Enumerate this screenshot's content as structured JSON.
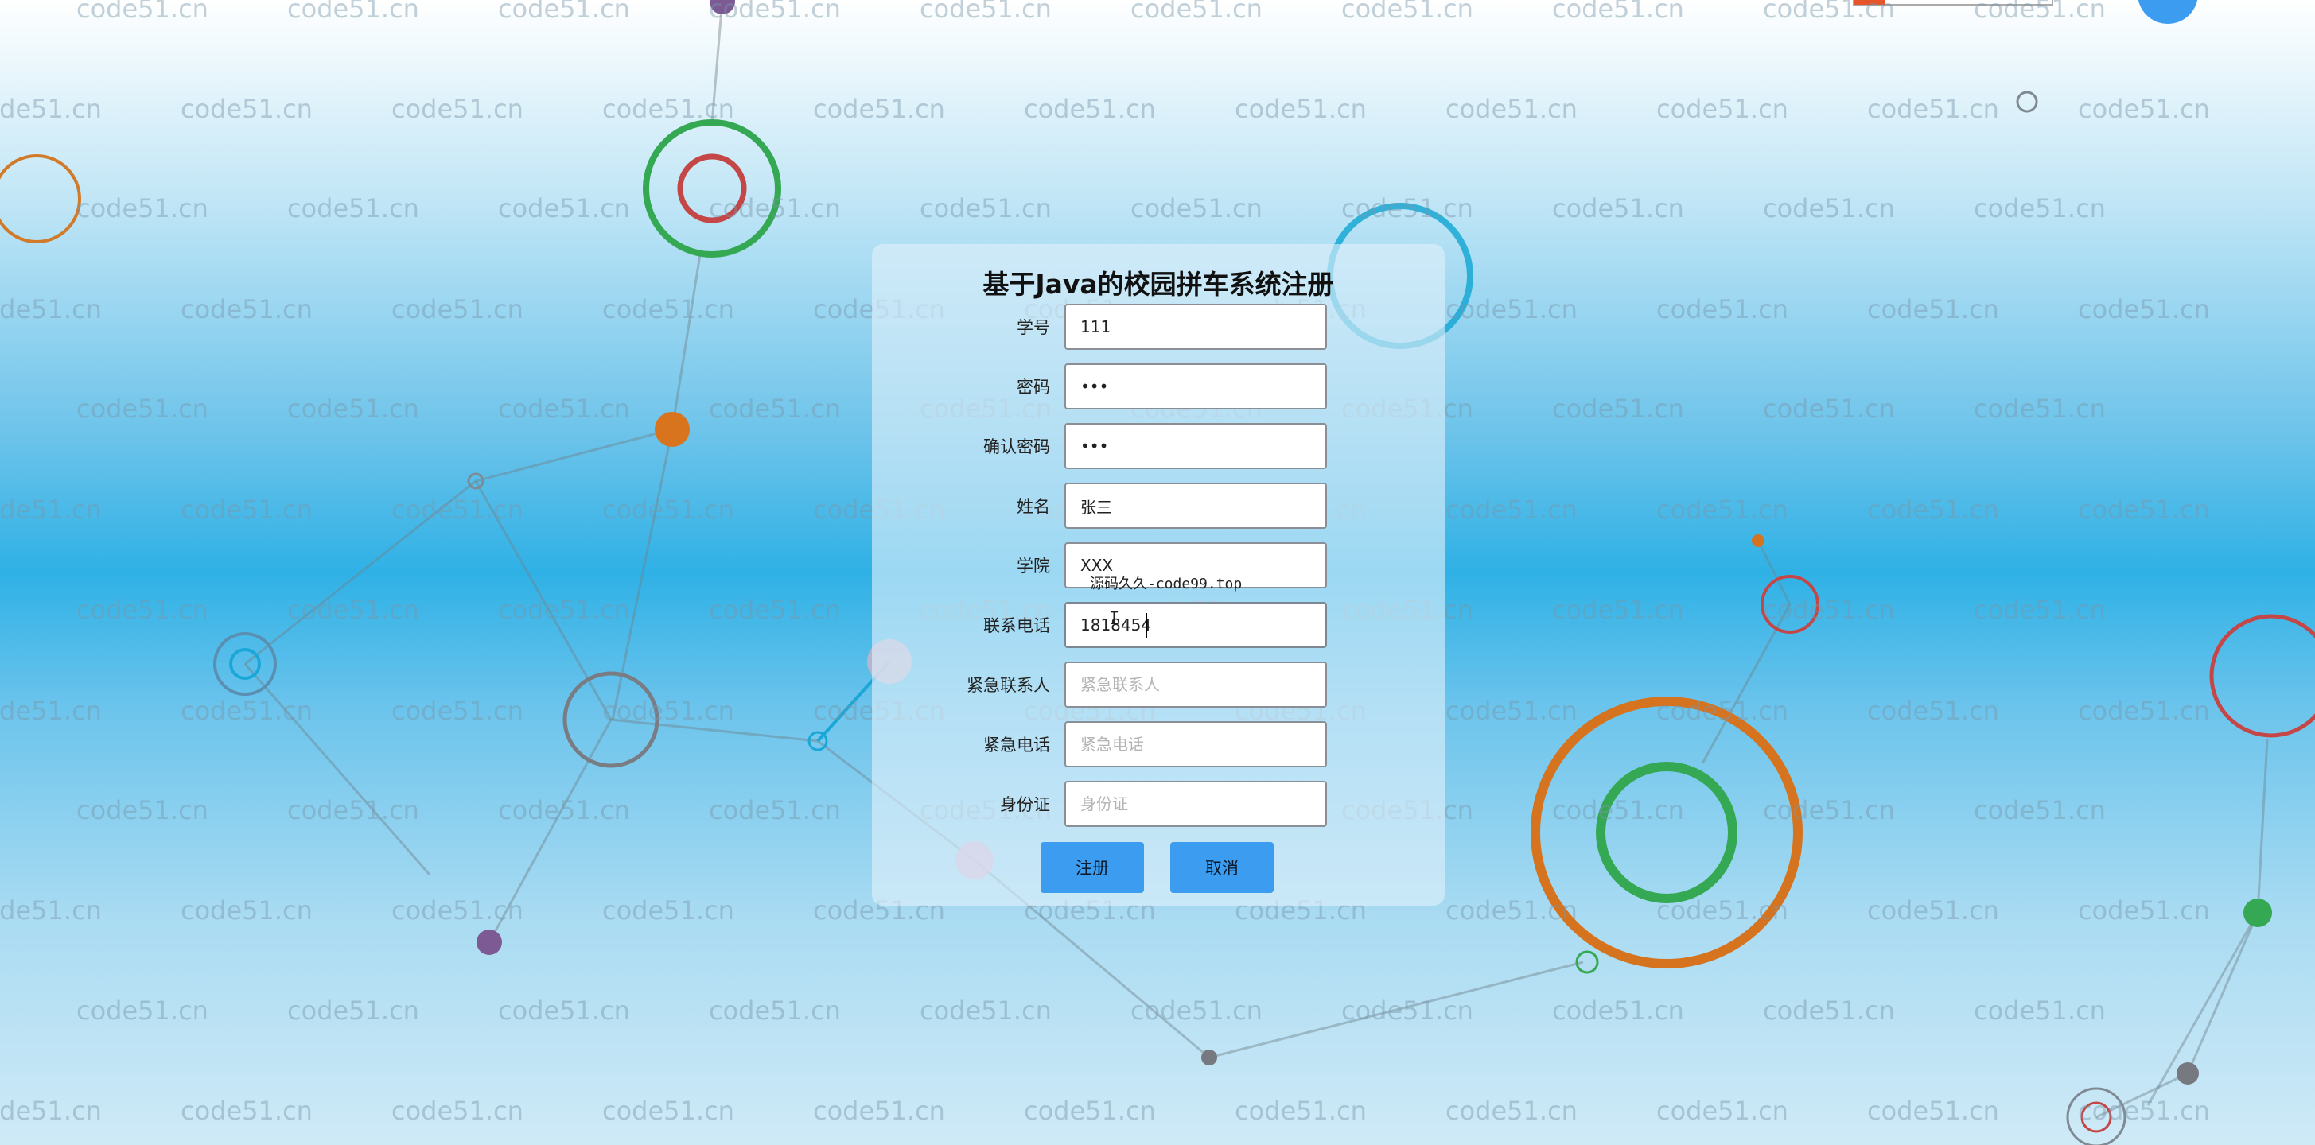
{
  "form": {
    "title": "基于Java的校园拼车系统注册",
    "fields": [
      {
        "label": "学号",
        "value": "111",
        "placeholder": ""
      },
      {
        "label": "密码",
        "value": "•••",
        "placeholder": ""
      },
      {
        "label": "确认密码",
        "value": "•••",
        "placeholder": ""
      },
      {
        "label": "姓名",
        "value": "张三",
        "placeholder": ""
      },
      {
        "label": "学院",
        "value": "XXX",
        "placeholder": ""
      },
      {
        "label": "联系电话",
        "value": "1818454",
        "placeholder": ""
      },
      {
        "label": "紧急联系人",
        "value": "",
        "placeholder": "紧急联系人"
      },
      {
        "label": "紧急电话",
        "value": "",
        "placeholder": "紧急电话"
      },
      {
        "label": "身份证",
        "value": "",
        "placeholder": "身份证"
      }
    ],
    "buttons": {
      "register": "注册",
      "cancel": "取消"
    }
  },
  "overlay": {
    "source_text": "源码久久-code99.top",
    "ibeam_glyph": "I"
  },
  "watermark": {
    "text": "code51.cn",
    "color": "#8fa6b5"
  },
  "colors": {
    "button": "#3b9cf0",
    "panel": "#e1f0fa"
  }
}
